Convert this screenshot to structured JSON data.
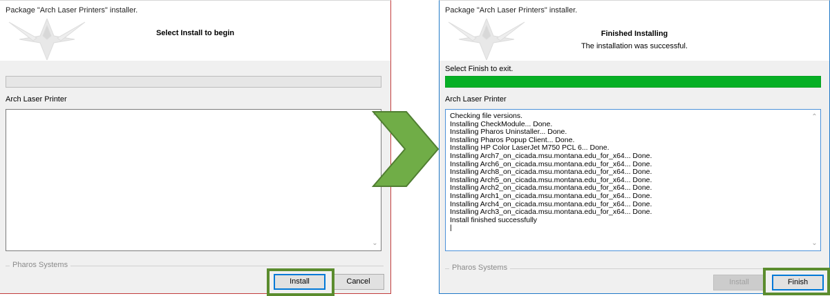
{
  "left": {
    "title": "Package \"Arch Laser Printers\" installer.",
    "heading": "Select Install to begin",
    "progress_fraction": 0,
    "group_label": "Arch Laser Printer",
    "log_text": "",
    "footer": "Pharos Systems",
    "install_label": "Install",
    "cancel_label": "Cancel"
  },
  "right": {
    "title": "Package \"Arch Laser Printers\" installer.",
    "heading": "Finished Installing",
    "subheading": "The installation was successful.",
    "instruction": "Select Finish to exit.",
    "progress_fraction": 1.0,
    "group_label": "Arch Laser Printer",
    "log_text": "Checking file versions.\nInstalling CheckModule... Done.\nInstalling Pharos Uninstaller... Done.\nInstalling Pharos Popup Client... Done.\nInstalling HP Color LaserJet M750 PCL 6... Done.\nInstalling Arch7_on_cicada.msu.montana.edu_for_x64... Done.\nInstalling Arch6_on_cicada.msu.montana.edu_for_x64... Done.\nInstalling Arch8_on_cicada.msu.montana.edu_for_x64... Done.\nInstalling Arch5_on_cicada.msu.montana.edu_for_x64... Done.\nInstalling Arch2_on_cicada.msu.montana.edu_for_x64... Done.\nInstalling Arch1_on_cicada.msu.montana.edu_for_x64... Done.\nInstalling Arch4_on_cicada.msu.montana.edu_for_x64... Done.\nInstalling Arch3_on_cicada.msu.montana.edu_for_x64... Done.\nInstall finished successfully\n|",
    "footer": "Pharos Systems",
    "install_label": "Install",
    "finish_label": "Finish"
  },
  "colors": {
    "highlight": "#5b8c2e",
    "arrow_fill": "#70ad47",
    "arrow_stroke": "#507e32",
    "progress_fill": "#06b025"
  },
  "icons": {
    "arrow": "chevron-right-arrow",
    "banner": "compass-star-graphic"
  }
}
